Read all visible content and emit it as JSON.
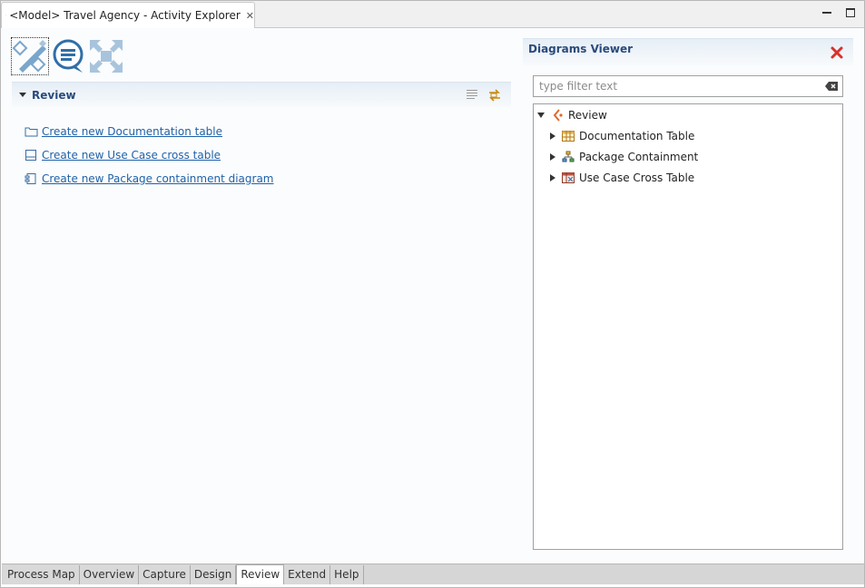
{
  "window": {
    "title": "<Model> Travel Agency - Activity Explorer",
    "close_glyph": "✕"
  },
  "review_section": {
    "title": "Review",
    "links": [
      {
        "label": "Create new Documentation table",
        "icon": "folder-outline-icon"
      },
      {
        "label": "Create new Use Case cross table",
        "icon": "table-outline-icon"
      },
      {
        "label": "Create new Package containment diagram",
        "icon": "package-diagram-icon"
      }
    ]
  },
  "diagrams_viewer": {
    "title": "Diagrams Viewer",
    "filter_placeholder": "type filter text",
    "tree": {
      "root": {
        "label": "Review",
        "expanded": true
      },
      "children": [
        {
          "label": "Documentation Table",
          "icon": "table-icon"
        },
        {
          "label": "Package Containment",
          "icon": "hierarchy-icon"
        },
        {
          "label": "Use Case Cross Table",
          "icon": "cross-table-icon"
        }
      ]
    }
  },
  "bottom_tabs": [
    {
      "label": "Process Map",
      "active": false
    },
    {
      "label": "Overview",
      "active": false
    },
    {
      "label": "Capture",
      "active": false
    },
    {
      "label": "Design",
      "active": false
    },
    {
      "label": "Review",
      "active": true
    },
    {
      "label": "Extend",
      "active": false
    },
    {
      "label": "Help",
      "active": false
    }
  ],
  "colors": {
    "accent": "#2a4b7c",
    "link": "#2062a8",
    "close_red": "#d9302c",
    "icon_blue": "#7aa6cc"
  }
}
